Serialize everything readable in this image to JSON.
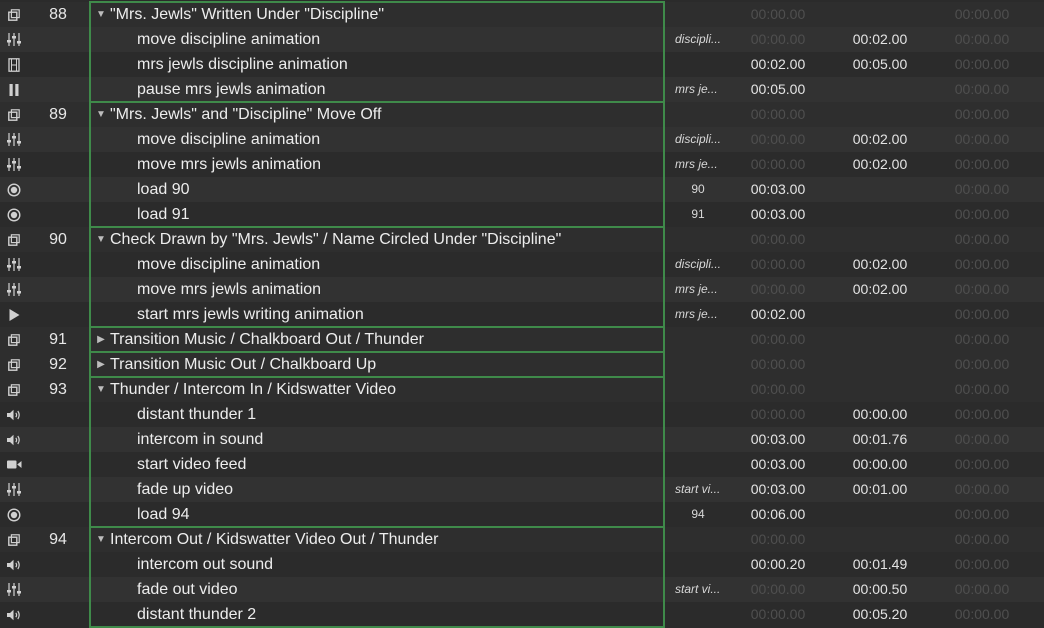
{
  "colors": {
    "background": "#2b2b2b",
    "group_border": "#3f8a4a",
    "text": "#e6e6e6",
    "dim_time": "#4f4f4f"
  },
  "rows": [
    {
      "icon": "group-icon",
      "number": "88",
      "name": "\"Mrs. Jewls\" Written Under \"Discipline\"",
      "child": false,
      "expand": "open",
      "target": "",
      "pre": "00:00.00",
      "action": "",
      "post": "00:00.00",
      "dim_pre": true,
      "dim_post": true
    },
    {
      "icon": "fade-icon",
      "number": "",
      "name": "move discipline animation",
      "child": true,
      "target": "discipli...",
      "pre": "00:00.00",
      "action": "00:02.00",
      "post": "00:00.00",
      "dim_pre": true,
      "dim_post": true
    },
    {
      "icon": "video-file-icon",
      "number": "",
      "name": "mrs jewls discipline animation",
      "child": true,
      "target": "",
      "pre": "00:02.00",
      "action": "00:05.00",
      "post": "00:00.00",
      "dim_pre": false,
      "dim_post": true
    },
    {
      "icon": "pause-icon",
      "number": "",
      "name": "pause mrs jewls animation",
      "child": true,
      "target": "mrs je...",
      "pre": "00:05.00",
      "action": "",
      "post": "00:00.00",
      "dim_pre": false,
      "dim_post": true
    },
    {
      "icon": "group-icon",
      "number": "89",
      "name": "\"Mrs. Jewls\" and \"Discipline\" Move Off",
      "child": false,
      "expand": "open",
      "target": "",
      "pre": "00:00.00",
      "action": "",
      "post": "00:00.00",
      "dim_pre": true,
      "dim_post": true
    },
    {
      "icon": "fade-icon",
      "number": "",
      "name": "move discipline animation",
      "child": true,
      "target": "discipli...",
      "pre": "00:00.00",
      "action": "00:02.00",
      "post": "00:00.00",
      "dim_pre": true,
      "dim_post": true
    },
    {
      "icon": "fade-icon",
      "number": "",
      "name": "move mrs jewls animation",
      "child": true,
      "target": "mrs je...",
      "pre": "00:00.00",
      "action": "00:02.00",
      "post": "00:00.00",
      "dim_pre": true,
      "dim_post": true
    },
    {
      "icon": "load-icon",
      "number": "",
      "name": "load 90",
      "child": true,
      "target": "90",
      "target_num": true,
      "pre": "00:03.00",
      "action": "",
      "post": "00:00.00",
      "dim_pre": false,
      "dim_post": true
    },
    {
      "icon": "load-icon",
      "number": "",
      "name": "load 91",
      "child": true,
      "target": "91",
      "target_num": true,
      "pre": "00:03.00",
      "action": "",
      "post": "00:00.00",
      "dim_pre": false,
      "dim_post": true
    },
    {
      "icon": "group-icon",
      "number": "90",
      "name": "Check Drawn by \"Mrs. Jewls\" / Name Circled Under \"Discipline\"",
      "child": false,
      "expand": "open",
      "target": "",
      "pre": "00:00.00",
      "action": "",
      "post": "00:00.00",
      "dim_pre": true,
      "dim_post": true
    },
    {
      "icon": "fade-icon",
      "number": "",
      "name": "move discipline animation",
      "child": true,
      "target": "discipli...",
      "pre": "00:00.00",
      "action": "00:02.00",
      "post": "00:00.00",
      "dim_pre": true,
      "dim_post": true
    },
    {
      "icon": "fade-icon",
      "number": "",
      "name": "move mrs jewls animation",
      "child": true,
      "target": "mrs je...",
      "pre": "00:00.00",
      "action": "00:02.00",
      "post": "00:00.00",
      "dim_pre": true,
      "dim_post": true
    },
    {
      "icon": "start-icon",
      "number": "",
      "name": "start mrs jewls writing animation",
      "child": true,
      "target": "mrs je...",
      "pre": "00:02.00",
      "action": "",
      "post": "00:00.00",
      "dim_pre": false,
      "dim_post": true
    },
    {
      "icon": "group-icon",
      "number": "91",
      "name": "Transition Music / Chalkboard Out / Thunder",
      "child": false,
      "expand": "closed",
      "target": "",
      "pre": "00:00.00",
      "action": "",
      "post": "00:00.00",
      "dim_pre": true,
      "dim_post": true
    },
    {
      "icon": "group-icon",
      "number": "92",
      "name": "Transition Music Out / Chalkboard Up",
      "child": false,
      "expand": "closed",
      "target": "",
      "pre": "00:00.00",
      "action": "",
      "post": "00:00.00",
      "dim_pre": true,
      "dim_post": true
    },
    {
      "icon": "group-icon",
      "number": "93",
      "name": "Thunder / Intercom In / Kidswatter Video",
      "child": false,
      "expand": "open",
      "target": "",
      "pre": "00:00.00",
      "action": "",
      "post": "00:00.00",
      "dim_pre": true,
      "dim_post": true
    },
    {
      "icon": "audio-icon",
      "number": "",
      "name": "distant thunder 1",
      "child": true,
      "target": "",
      "pre": "00:00.00",
      "action": "00:00.00",
      "post": "00:00.00",
      "dim_pre": true,
      "dim_post": true
    },
    {
      "icon": "audio-icon",
      "number": "",
      "name": "intercom in sound",
      "child": true,
      "target": "",
      "pre": "00:03.00",
      "action": "00:01.76",
      "post": "00:00.00",
      "dim_pre": false,
      "dim_post": true
    },
    {
      "icon": "camera-icon",
      "number": "",
      "name": "start video feed",
      "child": true,
      "target": "",
      "pre": "00:03.00",
      "action": "00:00.00",
      "post": "00:00.00",
      "dim_pre": false,
      "dim_post": true
    },
    {
      "icon": "fade-icon",
      "number": "",
      "name": "fade up video",
      "child": true,
      "target": "start vi...",
      "pre": "00:03.00",
      "action": "00:01.00",
      "post": "00:00.00",
      "dim_pre": false,
      "dim_post": true
    },
    {
      "icon": "load-icon",
      "number": "",
      "name": "load 94",
      "child": true,
      "target": "94",
      "target_num": true,
      "pre": "00:06.00",
      "action": "",
      "post": "00:00.00",
      "dim_pre": false,
      "dim_post": true
    },
    {
      "icon": "group-icon",
      "number": "94",
      "name": "Intercom Out / Kidswatter Video Out / Thunder",
      "child": false,
      "expand": "open",
      "target": "",
      "pre": "00:00.00",
      "action": "",
      "post": "00:00.00",
      "dim_pre": true,
      "dim_post": true
    },
    {
      "icon": "audio-icon",
      "number": "",
      "name": "intercom out sound",
      "child": true,
      "target": "",
      "pre": "00:00.20",
      "action": "00:01.49",
      "post": "00:00.00",
      "dim_pre": false,
      "dim_post": true
    },
    {
      "icon": "fade-icon",
      "number": "",
      "name": "fade out video",
      "child": true,
      "target": "start vi...",
      "pre": "00:00.00",
      "action": "00:00.50",
      "post": "00:00.00",
      "dim_pre": true,
      "dim_post": true
    },
    {
      "icon": "audio-icon",
      "number": "",
      "name": "distant thunder 2",
      "child": true,
      "target": "",
      "pre": "00:00.00",
      "action": "00:05.20",
      "post": "00:00.00",
      "dim_pre": true,
      "dim_post": true
    }
  ]
}
